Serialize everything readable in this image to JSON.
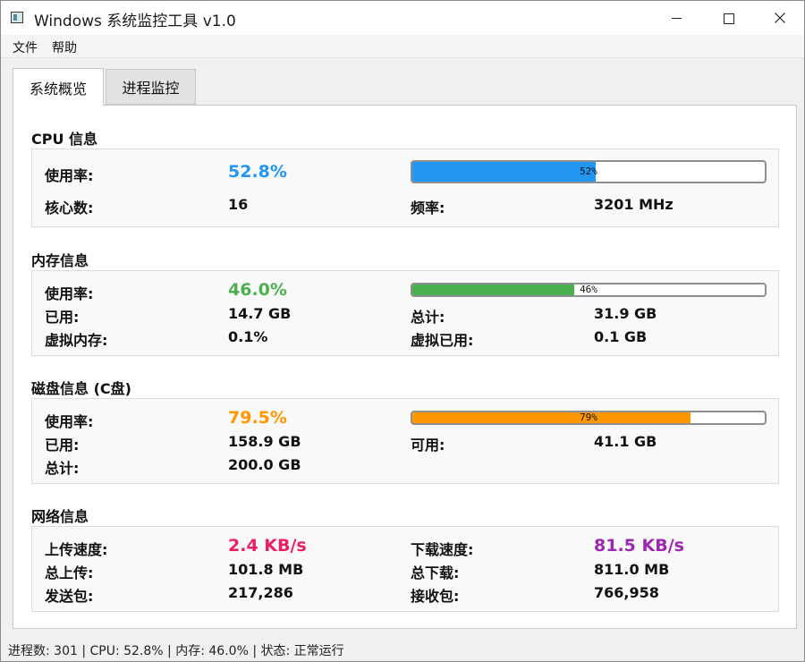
{
  "window": {
    "title": "Windows 系统监控工具 v1.0",
    "icons": [
      "app-icon",
      "minimize-icon",
      "maximize-icon",
      "close-icon"
    ]
  },
  "menu": {
    "file": "文件",
    "help": "帮助"
  },
  "tabs": {
    "overview": "系统概览",
    "process": "进程监控"
  },
  "cpu": {
    "title": "CPU 信息",
    "usage_label": "使用率:",
    "usage_value": "52.8%",
    "usage_color": "#2196F3",
    "bar_fraction": 0.52,
    "bar_text": "52%",
    "cores_label": "核心数:",
    "cores_value": "16",
    "freq_label": "频率:",
    "freq_value": "3201 MHz"
  },
  "memory": {
    "title": "内存信息",
    "usage_label": "使用率:",
    "usage_value": "46.0%",
    "usage_color": "#4CAF50",
    "bar_fraction": 0.46,
    "bar_text": "46%",
    "used_label": "已用:",
    "used_value": "14.7 GB",
    "total_label": "总计:",
    "total_value": "31.9 GB",
    "vmem_label": "虚拟内存:",
    "vmem_value": "0.1%",
    "vused_label": "虚拟已用:",
    "vused_value": "0.1 GB"
  },
  "disk": {
    "title": "磁盘信息 (C盘)",
    "usage_label": "使用率:",
    "usage_value": "79.5%",
    "usage_color": "#FF9800",
    "bar_fraction": 0.79,
    "bar_text": "79%",
    "used_label": "已用:",
    "used_value": "158.9 GB",
    "free_label": "可用:",
    "free_value": "41.1 GB",
    "total_label": "总计:",
    "total_value": "200.0 GB"
  },
  "network": {
    "title": "网络信息",
    "up_label": "上传速度:",
    "up_value": "2.4 KB/s",
    "up_color": "#E91E63",
    "down_label": "下载速度:",
    "down_value": "81.5 KB/s",
    "down_color": "#9C27B0",
    "total_up_label": "总上传:",
    "total_up_value": "101.8 MB",
    "total_down_label": "总下载:",
    "total_down_value": "811.0 MB",
    "sent_label": "发送包:",
    "sent_value": "217,286",
    "recv_label": "接收包:",
    "recv_value": "766,958"
  },
  "status": {
    "text": "进程数: 301 | CPU: 52.8% | 内存: 46.0% | 状态: 正常运行"
  }
}
